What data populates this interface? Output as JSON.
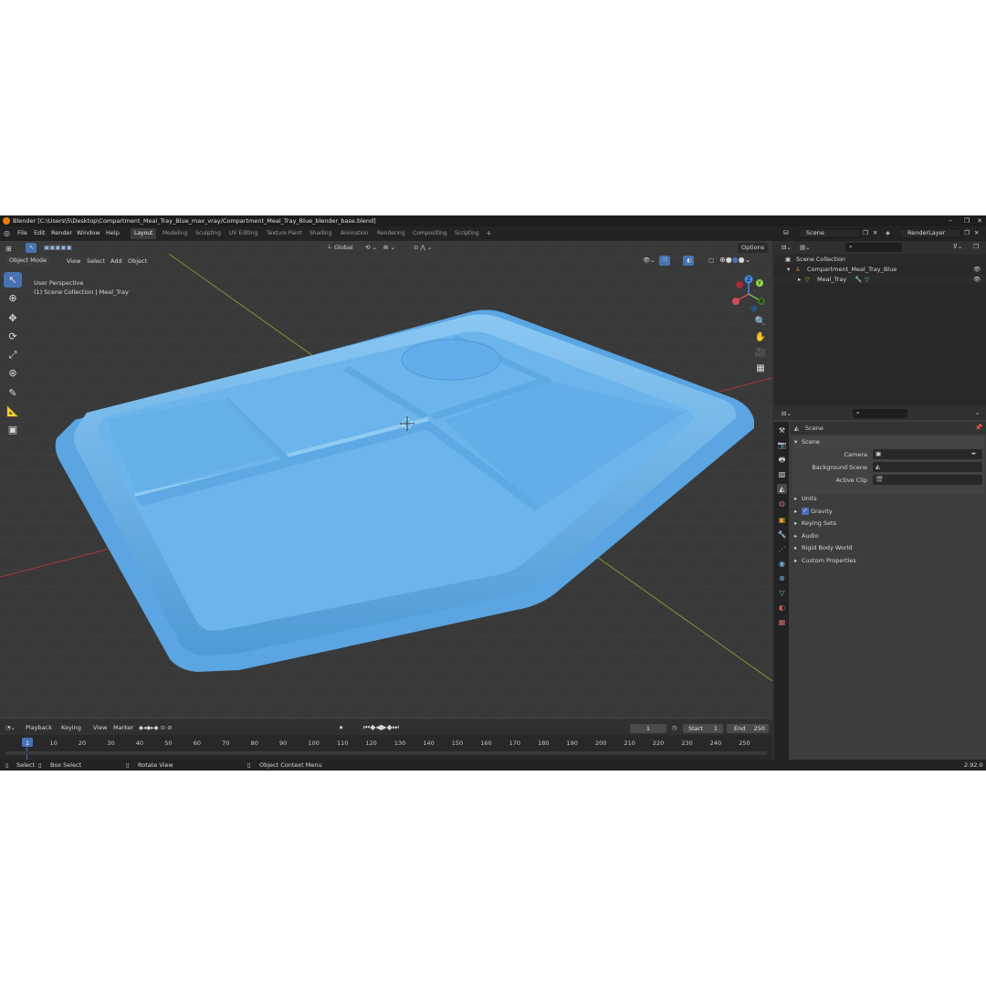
{
  "window": {
    "title": "Blender [C:\\Users\\5\\Desktop\\Compartment_Meal_Tray_Blue_max_vray/Compartment_Meal_Tray_Blue_blender_base.blend]",
    "minimize": "–",
    "maximize": "❐",
    "close": "✕"
  },
  "menu": [
    "File",
    "Edit",
    "Render",
    "Window",
    "Help"
  ],
  "workspaces": [
    "Layout",
    "Modeling",
    "Sculpting",
    "UV Editing",
    "Texture Paint",
    "Shading",
    "Animation",
    "Rendering",
    "Compositing",
    "Scripting"
  ],
  "add_workspace": "+",
  "scene_name": "Scene",
  "view_layer": "RenderLayer",
  "viewport": {
    "mode": "Object Mode",
    "menus": [
      "View",
      "Select",
      "Add",
      "Object"
    ],
    "orientation": "Global",
    "options": "Options",
    "overlay_line1": "User Perspective",
    "overlay_line2": "(1) Scene Collection | Meal_Tray",
    "gizmo": {
      "x": "X",
      "y": "Y",
      "z": "Z"
    },
    "tray_color": "#6bb4ec"
  },
  "outliner": {
    "root": "Scene Collection",
    "items": [
      {
        "label": "Compartment_Meal_Tray_Blue",
        "visible": true
      },
      {
        "label": "Meal_Tray",
        "visible": true
      }
    ]
  },
  "properties": {
    "context": "Scene",
    "panel": "Scene",
    "fields": [
      {
        "label": "Camera",
        "value": ""
      },
      {
        "label": "Background Scene",
        "value": ""
      },
      {
        "label": "Active Clip",
        "value": ""
      }
    ],
    "sections": [
      {
        "label": "Units",
        "checkbox": false
      },
      {
        "label": "Gravity",
        "checkbox": true
      },
      {
        "label": "Keying Sets",
        "checkbox": false
      },
      {
        "label": "Audio",
        "checkbox": false
      },
      {
        "label": "Rigid Body World",
        "checkbox": false
      },
      {
        "label": "Custom Properties",
        "checkbox": false
      }
    ]
  },
  "timeline": {
    "menus": [
      "Playback",
      "Keying",
      "View",
      "Marker"
    ],
    "current_frame": "1",
    "start_label": "Start",
    "start": "1",
    "end_label": "End",
    "end": "250",
    "ticks": [
      "1",
      "10",
      "20",
      "30",
      "40",
      "50",
      "60",
      "70",
      "80",
      "90",
      "100",
      "110",
      "120",
      "130",
      "140",
      "150",
      "160",
      "170",
      "180",
      "190",
      "200",
      "210",
      "220",
      "230",
      "240",
      "250"
    ]
  },
  "status": {
    "select": "Select",
    "box_select": "Box Select",
    "rotate_view": "Rotate View",
    "context_menu": "Object Context Menu",
    "version": "2.92.0"
  }
}
